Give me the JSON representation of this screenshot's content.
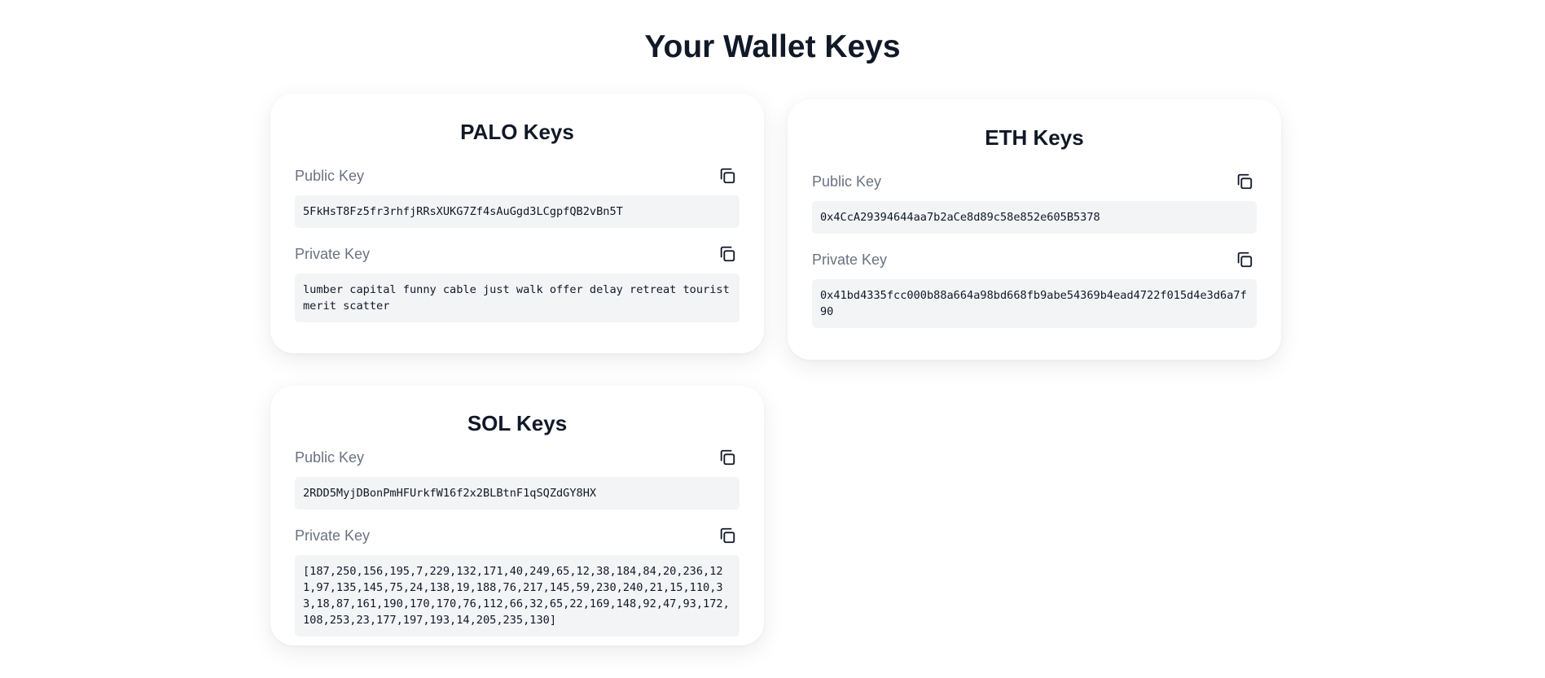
{
  "page": {
    "title": "Your Wallet Keys"
  },
  "cards": [
    {
      "title": "PALO Keys",
      "public_label": "Public Key",
      "public_value": "5FkHsT8Fz5fr3rhfjRRsXUKG7Zf4sAuGgd3LCgpfQB2vBn5T",
      "private_label": "Private Key",
      "private_value": "lumber capital funny cable just walk offer delay retreat tourist merit scatter"
    },
    {
      "title": "ETH Keys",
      "public_label": "Public Key",
      "public_value": "0x4CcA29394644aa7b2aCe8d89c58e852e605B5378",
      "private_label": "Private Key",
      "private_value": "0x41bd4335fcc000b88a664a98bd668fb9abe54369b4ead4722f015d4e3d6a7f90"
    },
    {
      "title": "SOL Keys",
      "public_label": "Public Key",
      "public_value": "2RDD5MyjDBonPmHFUrkfW16f2x2BLBtnF1qSQZdGY8HX",
      "private_label": "Private Key",
      "private_value": "[187,250,156,195,7,229,132,171,40,249,65,12,38,184,84,20,236,121,97,135,145,75,24,138,19,188,76,217,145,59,230,240,21,15,110,33,18,87,161,190,170,170,76,112,66,32,65,22,169,148,92,47,93,172,108,253,23,177,197,193,14,205,235,130]"
    }
  ],
  "icons": {
    "copy": "copy-icon"
  },
  "colors": {
    "background": "#ffffff",
    "card": "#ffffff",
    "key_box": "#f3f4f6",
    "label": "#6b7280",
    "text": "#111827"
  }
}
